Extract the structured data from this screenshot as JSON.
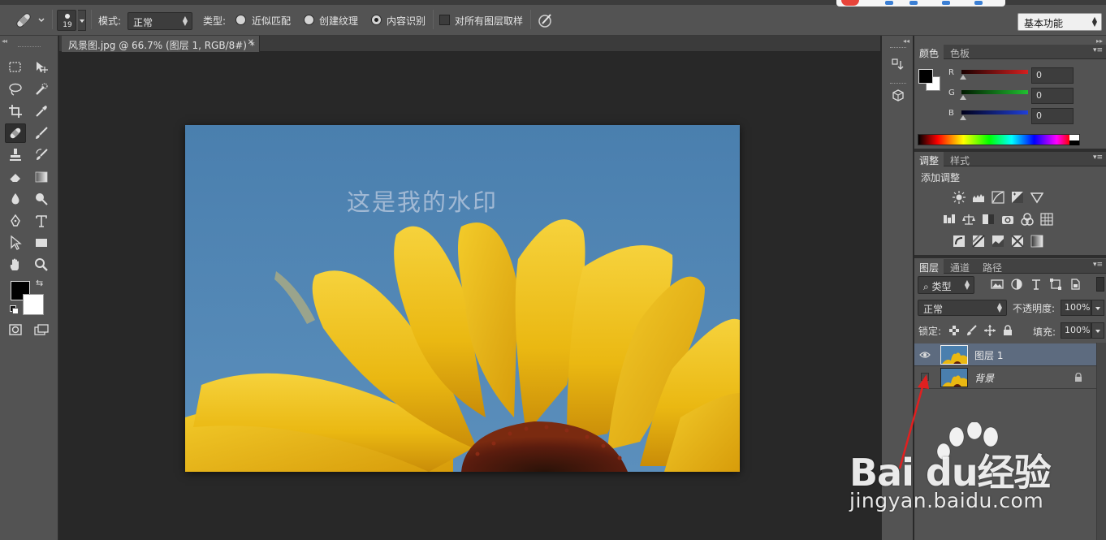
{
  "options_bar": {
    "brush_size": "19",
    "mode_label": "模式:",
    "mode_value": "正常",
    "type_label": "类型:",
    "type_options": [
      "近似匹配",
      "创建纹理",
      "内容识别"
    ],
    "type_selected": "内容识别",
    "sample_all_layers_label": "对所有图层取样",
    "sample_all_layers_checked": false,
    "workspace": "基本功能"
  },
  "tools": {
    "active": "spot-healing-brush",
    "items": [
      "marquee",
      "move",
      "lasso",
      "quick-selection",
      "crop",
      "eyedropper",
      "spot-healing-brush",
      "brush",
      "clone-stamp",
      "history-brush",
      "eraser",
      "gradient",
      "blur",
      "dodge",
      "pen",
      "type",
      "path-selection",
      "rectangle",
      "hand",
      "zoom"
    ],
    "foreground_color": "#000000",
    "background_color": "#ffffff"
  },
  "document": {
    "tab_title": "风景图.jpg @ 66.7% (图层 1, RGB/8#) *",
    "watermark_text": "这是我的水印"
  },
  "color_panel": {
    "tabs": [
      "颜色",
      "色板"
    ],
    "active_tab": "颜色",
    "channels": [
      {
        "label": "R",
        "value": "0",
        "color": "#d42020"
      },
      {
        "label": "G",
        "value": "0",
        "color": "#20c030"
      },
      {
        "label": "B",
        "value": "0",
        "color": "#2040d8"
      }
    ]
  },
  "adjustments_panel": {
    "tabs": [
      "调整",
      "样式"
    ],
    "active_tab": "调整",
    "title": "添加调整",
    "icons": [
      "brightness-contrast",
      "levels",
      "curves",
      "exposure",
      "vibrance",
      "hue-saturation",
      "color-balance",
      "black-white",
      "photo-filter",
      "channel-mixer",
      "color-lookup",
      "invert",
      "posterize",
      "threshold",
      "selective-color",
      "gradient-map"
    ]
  },
  "layers_panel": {
    "tabs": [
      "图层",
      "通道",
      "路径"
    ],
    "active_tab": "图层",
    "filter_kind": "类型",
    "blend_mode": "正常",
    "opacity_label": "不透明度:",
    "opacity_value": "100%",
    "lock_label": "锁定:",
    "fill_label": "填充:",
    "fill_value": "100%",
    "layers": [
      {
        "name": "图层 1",
        "visible": true,
        "selected": true,
        "locked": false
      },
      {
        "name": "背景",
        "visible": false,
        "selected": false,
        "locked": true
      }
    ]
  },
  "overlay": {
    "brand_text": "Bai du经验",
    "domain_text": "jingyan.baidu.com",
    "arrow_color": "#e02020"
  }
}
